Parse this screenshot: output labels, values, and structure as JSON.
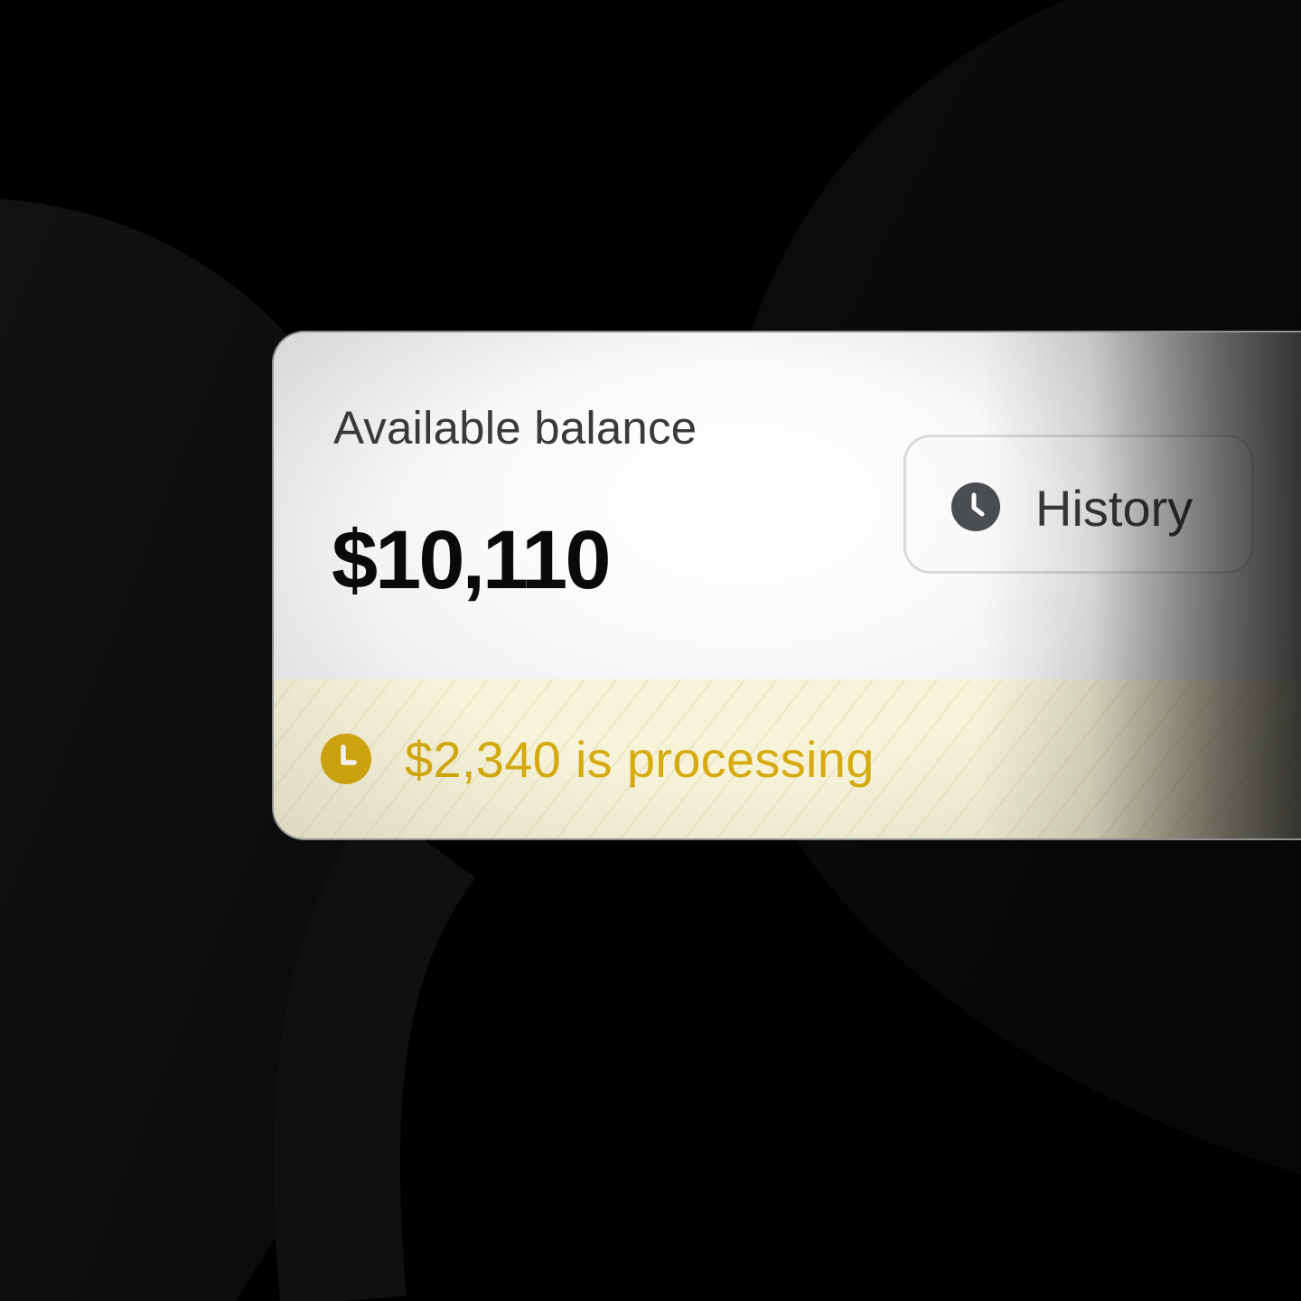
{
  "balance": {
    "label": "Available balance",
    "amount": "$10,110"
  },
  "history_button": {
    "label": "History",
    "icon": "clock-icon"
  },
  "processing": {
    "text": "$2,340 is processing",
    "icon": "clock-icon",
    "color": "#d6ab0f"
  },
  "colors": {
    "background": "#000000",
    "card": "#ffffff",
    "processing_bg": "#f7f3d8",
    "amount_text": "#0a0a0a"
  }
}
